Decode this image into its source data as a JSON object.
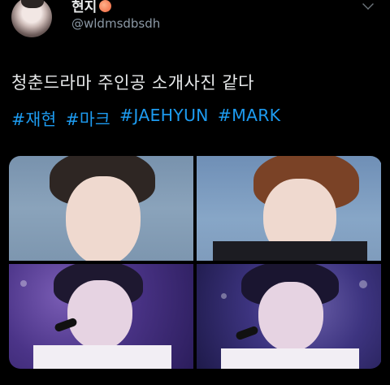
{
  "tweet": {
    "display_name": "현지",
    "name_emoji_icon": "peach-icon",
    "handle": "@wldmsdbsdh",
    "text": "청춘드라마 주인공 소개사진 같다",
    "hashtags": [
      "#재현",
      "#마크",
      "#JAEHYUN",
      "#MARK"
    ],
    "menu_icon": "chevron-down-icon"
  },
  "colors": {
    "background": "#000000",
    "text": "#e7e9ea",
    "secondary_text": "#8b98a5",
    "link": "#1d9bf0"
  },
  "media": {
    "photo_count": 4
  }
}
